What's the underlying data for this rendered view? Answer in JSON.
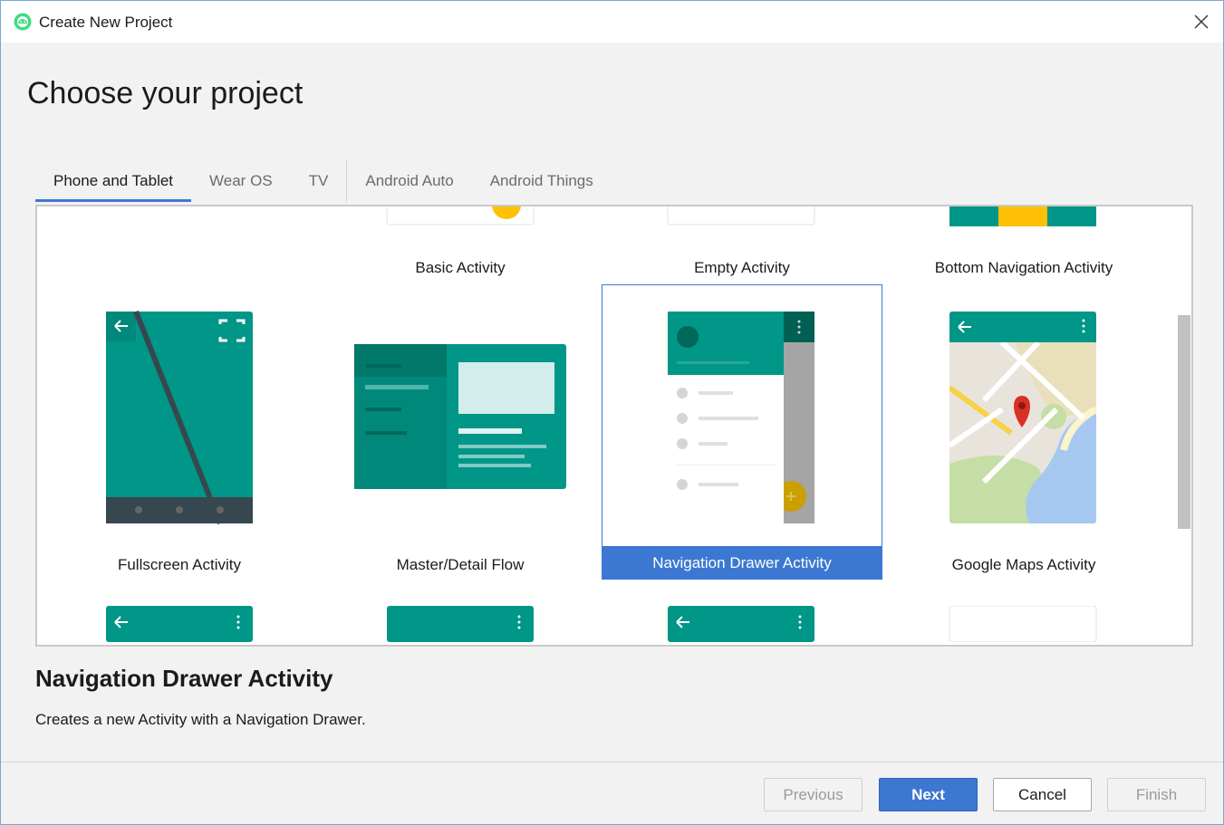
{
  "window": {
    "title": "Create New Project",
    "close_label": "✕"
  },
  "page": {
    "heading": "Choose your project"
  },
  "tabs": [
    {
      "label": "Phone and Tablet",
      "active": true
    },
    {
      "label": "Wear OS"
    },
    {
      "label": "TV"
    },
    {
      "label": "Android Auto"
    },
    {
      "label": "Android Things"
    }
  ],
  "templates": {
    "row1": [
      "Basic Activity",
      "Empty Activity",
      "Bottom Navigation Activity"
    ],
    "row2": [
      "Fullscreen Activity",
      "Master/Detail Flow",
      "Navigation Drawer Activity",
      "Google Maps Activity"
    ],
    "selected": "Navigation Drawer Activity"
  },
  "description": {
    "title": "Navigation Drawer Activity",
    "text": "Creates a new Activity with a Navigation Drawer."
  },
  "buttons": {
    "previous": "Previous",
    "next": "Next",
    "cancel": "Cancel",
    "finish": "Finish"
  },
  "colors": {
    "accent": "#3c78d2",
    "teal": "#009688",
    "teal_dark": "#00796b",
    "amber": "#ffc107"
  }
}
